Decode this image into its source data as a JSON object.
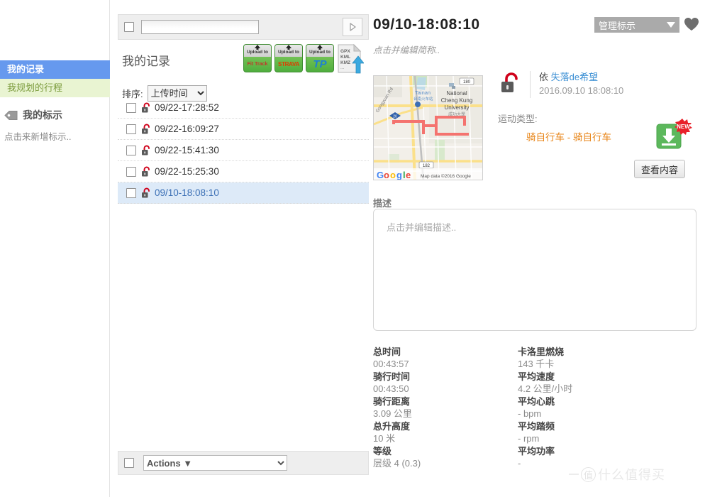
{
  "sidebar": {
    "items": [
      {
        "label": "我的记录",
        "state": "active"
      },
      {
        "label": "我规划的行程",
        "state": "normal"
      }
    ],
    "tags": {
      "icon": "tag-icon",
      "title": "我的标示",
      "hint": "点击来新增标示.."
    }
  },
  "middle": {
    "search": {
      "placeholder": "",
      "value": "",
      "go_icon": "play-triangle-icon"
    },
    "title": "我的记录",
    "sort": {
      "label": "排序:",
      "selected": "上传时间",
      "options": [
        "上传时间"
      ]
    },
    "uploads": [
      {
        "top": "Upload to",
        "brand": "Fit Track",
        "name": "upload-to-fittrack"
      },
      {
        "top": "Upload to",
        "brand": "STRAVA",
        "name": "upload-to-strava"
      },
      {
        "top": "Upload to",
        "brand": "TP",
        "name": "upload-to-trainingpeaks"
      }
    ],
    "gpx": {
      "lines": [
        "GPX",
        "KML",
        "KMZ",
        "..."
      ],
      "name": "download-gpx-kml-kmz"
    },
    "records": [
      {
        "label": "09/22-17:28:52",
        "lock": "unlock-icon",
        "selected": false,
        "checked": false
      },
      {
        "label": "09/22-16:09:27",
        "lock": "unlock-icon",
        "selected": false,
        "checked": false
      },
      {
        "label": "09/22-15:41:30",
        "lock": "unlock-icon",
        "selected": false,
        "checked": false
      },
      {
        "label": "09/22-15:25:30",
        "lock": "unlock-icon",
        "selected": false,
        "checked": false
      },
      {
        "label": "09/10-18:08:10",
        "lock": "unlock-icon",
        "selected": true,
        "checked": false
      }
    ],
    "footer": {
      "actions_label": "Actions ▼",
      "options": [
        "Actions ▼"
      ]
    }
  },
  "detail": {
    "title": "09/10-18:08:10",
    "subtitle": "点击并编辑简称..",
    "tag_manage": {
      "label": "管理标示",
      "caret": "chevron-down-icon"
    },
    "favorite_icon": "heart-icon",
    "map": {
      "labels": [
        "Gongyuan Rd",
        "Tainan",
        "台南火车站",
        "National",
        "Cheng Kung",
        "University",
        "成功大學",
        "180",
        "182",
        "20"
      ],
      "attribution": "Map data ©2016 Google",
      "logo": "Google"
    },
    "privacy_icon": "unlock-icon",
    "owner": {
      "prefix": "依",
      "name": "失落de希望",
      "date": "2016.09.10 18:08:10"
    },
    "sport": {
      "label": "运动类型:",
      "value": "骑自行车 - 骑自行车"
    },
    "download_badge": {
      "label": "NEW",
      "icon": "download-icon"
    },
    "view_button": "查看内容",
    "description": {
      "label": "描述",
      "placeholder": "点击并编辑描述..",
      "value": ""
    },
    "stats": [
      {
        "key": "总时间",
        "value": "00:43:57"
      },
      {
        "key": "卡洛里燃烧",
        "value": "143 千卡"
      },
      {
        "key": "骑行时间",
        "value": "00:43:50"
      },
      {
        "key": "平均速度",
        "value": "4.2 公里/小时"
      },
      {
        "key": "骑行距离",
        "value": "3.09 公里"
      },
      {
        "key": "平均心跳",
        "value": "- bpm"
      },
      {
        "key": "总升高度",
        "value": "10 米"
      },
      {
        "key": "平均踏频",
        "value": "- rpm"
      },
      {
        "key": "等级",
        "value": "层级 4 (0.3)"
      },
      {
        "key": "平均功率",
        "value": "-"
      }
    ],
    "collapse_icon": "triangle-up-icon"
  },
  "watermark": {
    "mark": "值",
    "text": "什么值得买"
  },
  "colors": {
    "accent_blue": "#6699ee",
    "soft_green": "#e9f4d2",
    "selected_row": "#ddeaf8",
    "link_blue": "#3b8fd4",
    "sport_orange": "#e8861a",
    "upload_green": "#4fae3e",
    "lock_red": "#d0021b"
  }
}
